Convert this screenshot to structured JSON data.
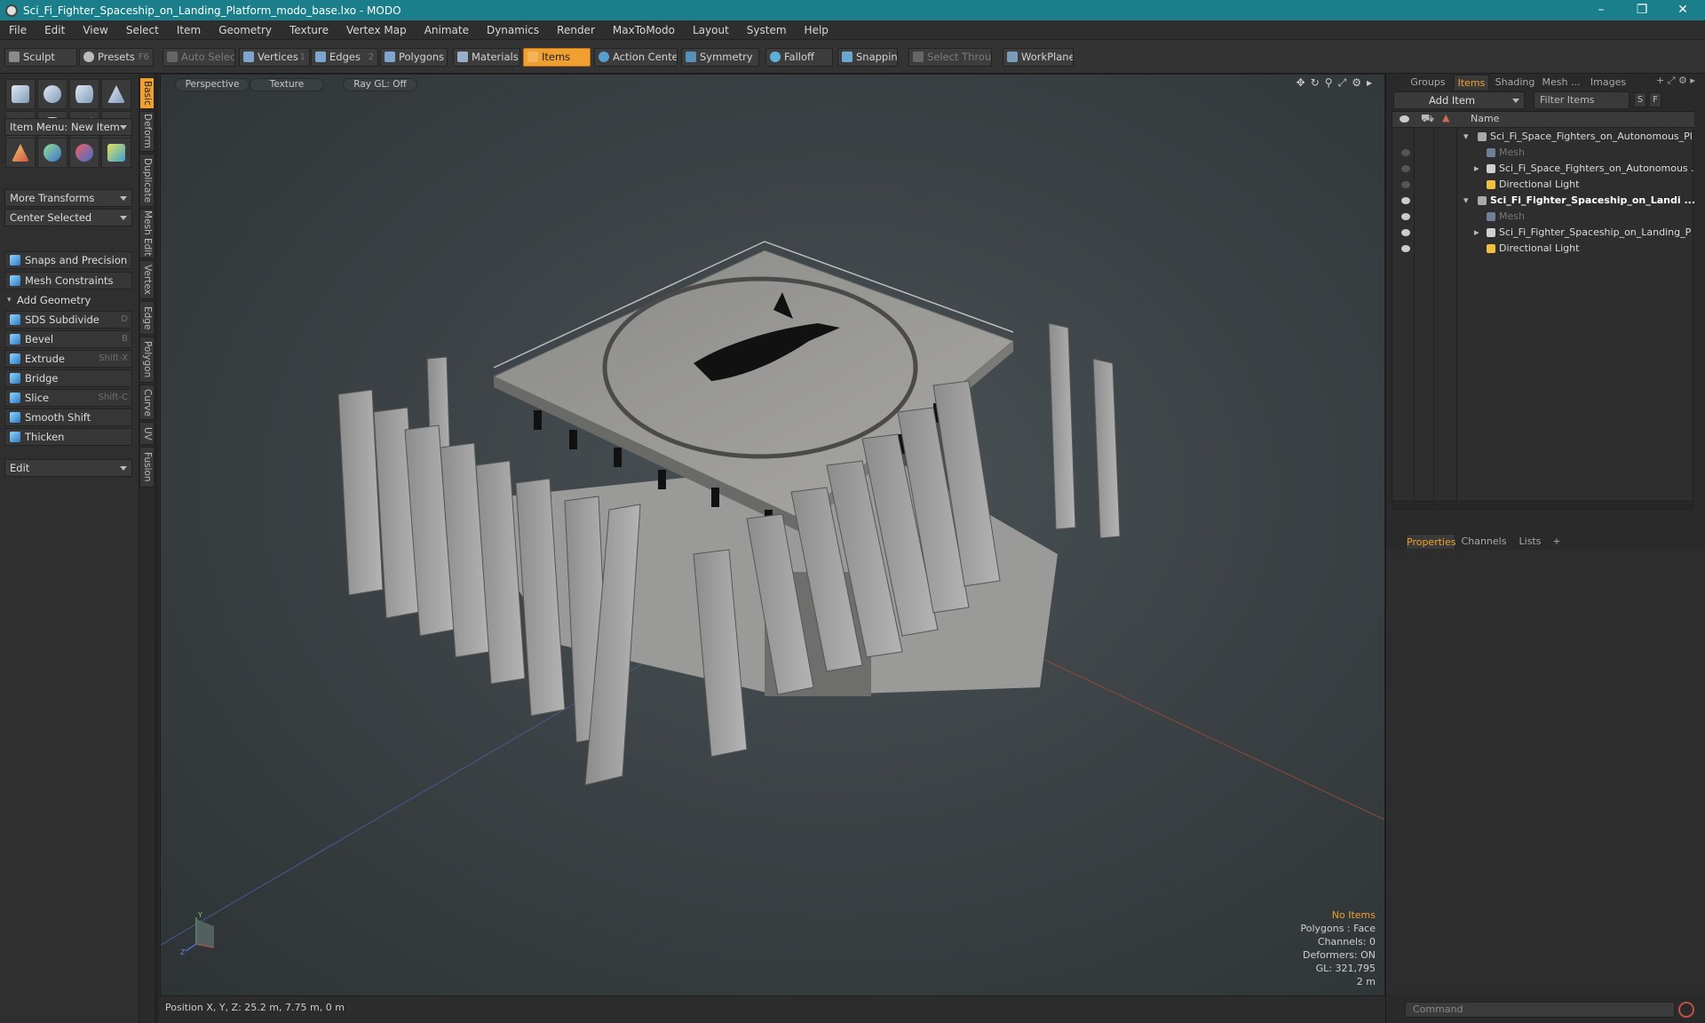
{
  "window": {
    "title": "Sci_Fi_Fighter_Spaceship_on_Landing_Platform_modo_base.lxo - MODO"
  },
  "menu": [
    "File",
    "Edit",
    "View",
    "Select",
    "Item",
    "Geometry",
    "Texture",
    "Vertex Map",
    "Animate",
    "Dynamics",
    "Render",
    "MaxToModo",
    "Layout",
    "System",
    "Help"
  ],
  "toolbar": {
    "sculpt": "Sculpt",
    "presets": "Presets",
    "presets_key": "F6",
    "auto_select": "Auto Select",
    "vertices": "Vertices",
    "vertices_key": "1",
    "edges": "Edges",
    "edges_key": "2",
    "polygons": "Polygons",
    "materials": "Materials",
    "items": "Items",
    "action_center": "Action Center",
    "symmetry": "Symmetry",
    "falloff": "Falloff",
    "snapping": "Snapping",
    "select_through": "Select Through",
    "workplane": "WorkPlane"
  },
  "left": {
    "item_menu": "Item Menu: New Item",
    "more_transforms": "More Transforms",
    "center_selected": "Center Selected",
    "snaps": "Snaps and Precision",
    "mesh_constraints": "Mesh Constraints",
    "add_geometry": "Add Geometry",
    "tools": [
      {
        "label": "SDS Subdivide",
        "key": "D"
      },
      {
        "label": "Bevel",
        "key": "B"
      },
      {
        "label": "Extrude",
        "key": "Shift-X"
      },
      {
        "label": "Bridge",
        "key": ""
      },
      {
        "label": "Slice",
        "key": "Shift-C"
      },
      {
        "label": "Smooth Shift",
        "key": ""
      },
      {
        "label": "Thicken",
        "key": ""
      }
    ],
    "edit_mode": "Edit"
  },
  "vtabs": [
    "Basic",
    "Deform",
    "Duplicate",
    "Mesh Edit",
    "Vertex",
    "Edge",
    "Polygon",
    "Curve",
    "UV",
    "Fusion"
  ],
  "viewport": {
    "view": "Perspective",
    "shading": "Texture",
    "raygl": "Ray GL: Off",
    "info": {
      "selection": "No Items",
      "polygons": "Polygons : Face",
      "channels": "Channels: 0",
      "deformers": "Deformers: ON",
      "gl": "GL: 321,795",
      "scale": "2 m"
    },
    "axis_y": "Y",
    "axis_z": "Z"
  },
  "status": {
    "position": "Position X, Y, Z:  25.2 m, 7.75 m, 0 m"
  },
  "right": {
    "tabs": [
      "Groups",
      "Items",
      "Shading",
      "Mesh ...",
      "Images"
    ],
    "add_item": "Add Item",
    "filter": "Filter Items",
    "filter_s": "S",
    "filter_f": "F",
    "name_col": "Name",
    "tree": [
      {
        "label": "Sci_Fi_Space_Fighters_on_Autonomous_Pl ...",
        "level": 0,
        "bold": false,
        "dim": false,
        "expand": "down"
      },
      {
        "label": "Mesh",
        "level": 1,
        "bold": false,
        "dim": true,
        "expand": ""
      },
      {
        "label": "Sci_Fi_Space_Fighters_on_Autonomous ...",
        "level": 1,
        "bold": false,
        "dim": false,
        "expand": "right"
      },
      {
        "label": "Directional Light",
        "level": 1,
        "bold": false,
        "dim": false,
        "expand": ""
      },
      {
        "label": "Sci_Fi_Fighter_Spaceship_on_Landi ...",
        "level": 0,
        "bold": true,
        "dim": false,
        "expand": "down"
      },
      {
        "label": "Mesh",
        "level": 1,
        "bold": false,
        "dim": true,
        "expand": ""
      },
      {
        "label": "Sci_Fi_Fighter_Spaceship_on_Landing_P ...",
        "level": 1,
        "bold": false,
        "dim": false,
        "expand": "right"
      },
      {
        "label": "Directional Light",
        "level": 1,
        "bold": false,
        "dim": false,
        "expand": ""
      }
    ],
    "bottom_tabs": [
      "Properties",
      "Channels",
      "Lists"
    ],
    "command_placeholder": "Command"
  }
}
